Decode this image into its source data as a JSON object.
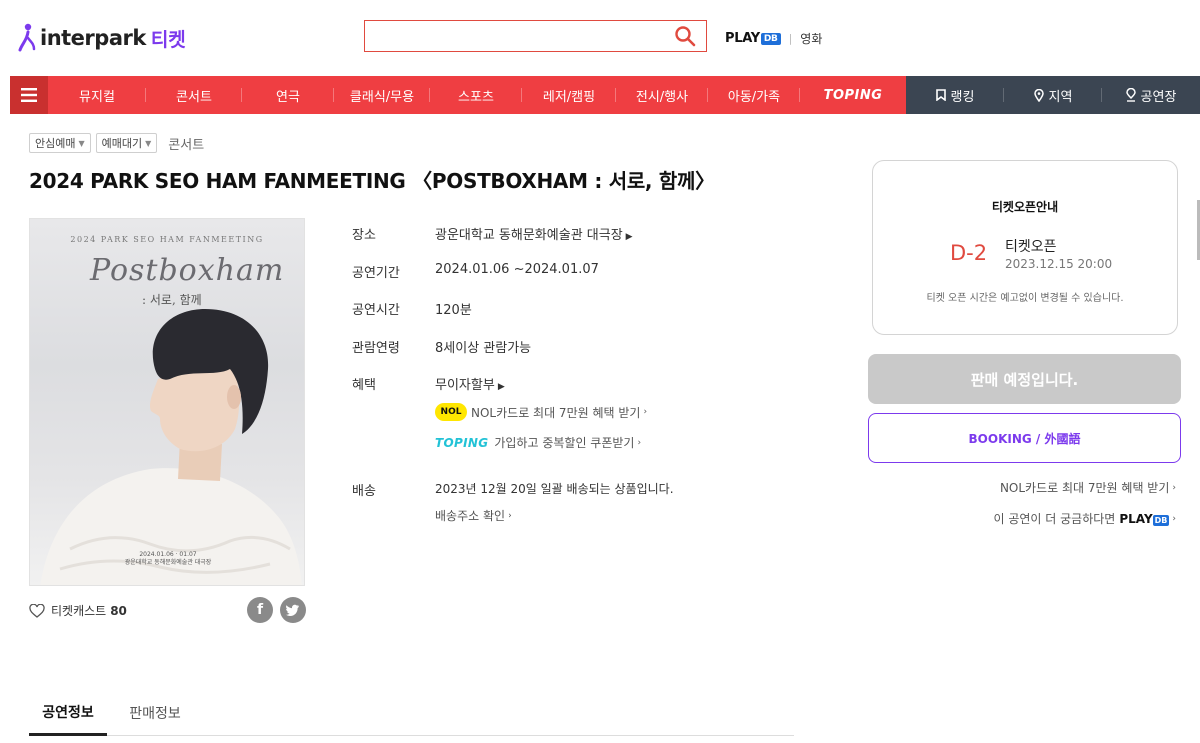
{
  "header": {
    "logo_text": "interpark",
    "logo_sub": "티켓",
    "search": {
      "value": "",
      "placeholder": ""
    },
    "playdb": "PLAY",
    "playdb_db": "DB",
    "movie_link": "영화"
  },
  "nav": {
    "items": [
      "뮤지컬",
      "콘서트",
      "연극",
      "클래식/무용",
      "스포츠",
      "레저/캠핑",
      "전시/행사",
      "아동/가족",
      "TOPING"
    ],
    "right": [
      "랭킹",
      "지역",
      "공연장"
    ]
  },
  "tags": [
    "안심예매",
    "예매대기"
  ],
  "breadcrumb": "콘서트",
  "title": "2024 PARK SEO HAM FANMEETING 〈POSTBOXHAM : 서로, 함께〉",
  "poster": {
    "top": "2024 PARK SEO HAM FANMEETING",
    "script": "Postboxham",
    "sub": ": 서로, 함께"
  },
  "ticketcast": {
    "label": "티켓캐스트",
    "count": "80"
  },
  "info": {
    "venue_label": "장소",
    "venue": "광운대학교 동해문화예술관 대극장",
    "period_label": "공연기간",
    "period": "2024.01.06 ~2024.01.07",
    "runtime_label": "공연시간",
    "runtime": "120분",
    "age_label": "관람연령",
    "age": "8세이상 관람가능",
    "benefit_label": "혜택",
    "benefit": "무이자할부",
    "nol_badge": "NOL",
    "nol_text": "NOL카드로 최대 7만원 혜택 받기",
    "toping_badge": "TOPING",
    "toping_text": "가입하고 중복할인 쿠폰받기",
    "delivery_label": "배송",
    "delivery": "2023년 12월 20일 일괄 배송되는 상품입니다.",
    "delivery_link": "배송주소 확인"
  },
  "ticket_open": {
    "title": "티켓오픈안내",
    "dday": "D-2",
    "label": "티켓오픈",
    "date": "2023.12.15 20:00",
    "note": "티켓 오픈 시간은 예고없이 변경될 수 있습니다."
  },
  "buttons": {
    "soon": "판매 예정입니다.",
    "booking": "BOOKING / 外國語"
  },
  "side_links": {
    "nol": "NOL카드로 최대 7만원 혜택 받기",
    "playdb_prefix": "이 공연이 더 궁금하다면",
    "playdb": "PLAY",
    "playdb_db": "DB"
  },
  "tabs": [
    "공연정보",
    "판매정보"
  ],
  "colors": {
    "brand_red": "#ef3e42",
    "brand_purple": "#7c3aed",
    "nav_dark": "#3b4552"
  }
}
